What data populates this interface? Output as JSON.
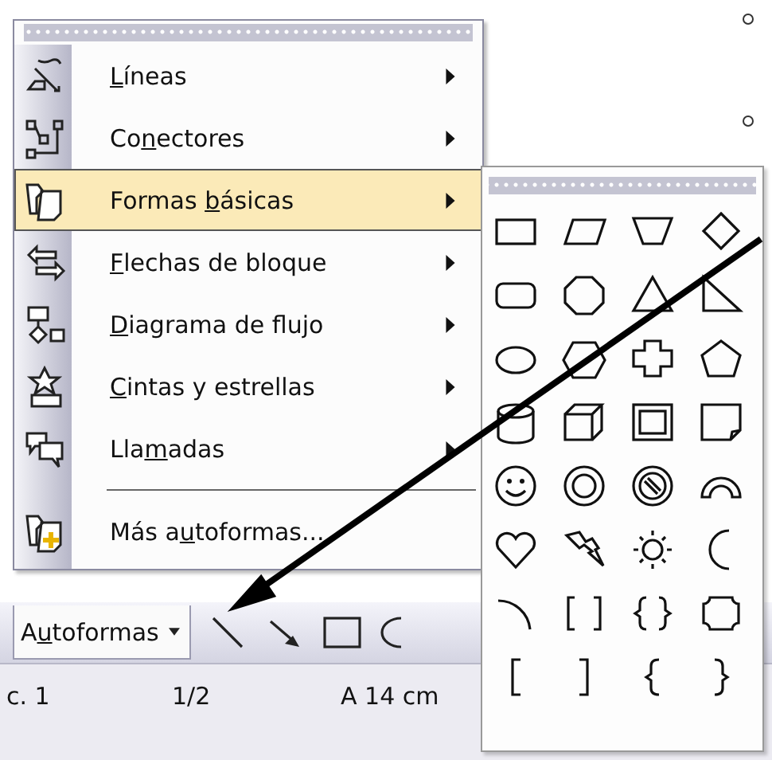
{
  "menu": {
    "items": [
      {
        "kind": "submenu",
        "mnemonic": "L",
        "after": "íneas",
        "selected": false
      },
      {
        "kind": "submenu",
        "before": "Co",
        "mnemonic": "n",
        "after": "ectores",
        "selected": false
      },
      {
        "kind": "submenu",
        "before": "Formas ",
        "mnemonic": "b",
        "after": "ásicas",
        "selected": true
      },
      {
        "kind": "submenu",
        "mnemonic": "F",
        "after": "lechas de bloque",
        "selected": false
      },
      {
        "kind": "submenu",
        "mnemonic": "D",
        "after": "iagrama de flujo",
        "selected": false
      },
      {
        "kind": "submenu",
        "mnemonic": "C",
        "after": "intas y estrellas",
        "selected": false
      },
      {
        "kind": "submenu",
        "before": "Lla",
        "mnemonic": "m",
        "after": "adas",
        "selected": false
      },
      {
        "kind": "separator"
      },
      {
        "kind": "command",
        "before": "Más a",
        "mnemonic": "u",
        "after": "toformas...",
        "selected": false
      }
    ]
  },
  "toolbar": {
    "autoshapes_button": {
      "before": "A",
      "mnemonic": "u",
      "after": "toformas"
    }
  },
  "status_bar": {
    "page": "c. 1",
    "pages": "1/2",
    "position": "A 14 cm"
  }
}
